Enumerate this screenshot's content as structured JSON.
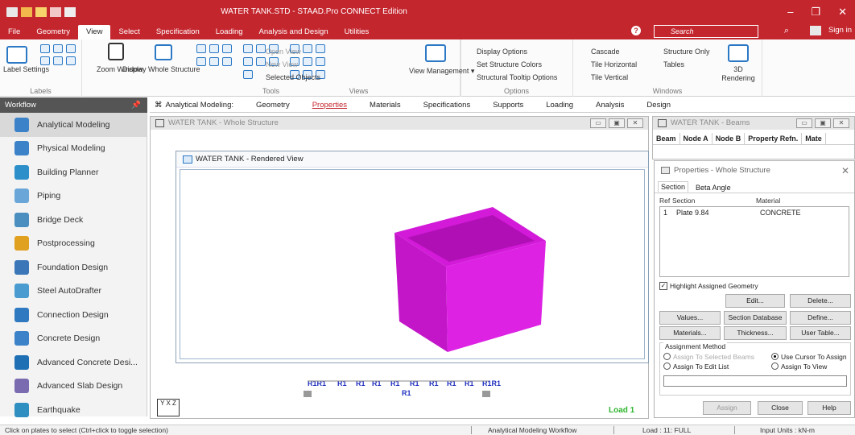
{
  "window": {
    "title": "WATER TANK.STD - STAAD.Pro CONNECT Edition",
    "search_placeholder": "Search",
    "signin": "Sign in",
    "controls": [
      "–",
      "❐",
      "✕"
    ]
  },
  "menu": [
    "File",
    "Geometry",
    "View",
    "Select",
    "Specification",
    "Loading",
    "Analysis and Design",
    "Utilities"
  ],
  "menu_active": "View",
  "ribbon": {
    "labels_group": {
      "label": "Labels",
      "button": "Label Settings"
    },
    "tools_group": {
      "label": "Tools",
      "zoom": "Zoom Window",
      "display": "Display Whole Structure"
    },
    "views_group": {
      "label": "Views",
      "open_view": "Open View",
      "new_view": "New View",
      "selected_objects": "Selected Objects",
      "view_management": "View Management ▾"
    },
    "options_group": {
      "label": "Options",
      "display_options": "Display Options",
      "set_colors": "Set Structure Colors",
      "tooltip_options": "Structural Tooltip Options"
    },
    "windows_group": {
      "label": "Windows",
      "cascade": "Cascade",
      "tile_h": "Tile Horizontal",
      "tile_v": "Tile Vertical",
      "structure_only": "Structure Only",
      "tables": "Tables",
      "rendering": "3D Rendering"
    }
  },
  "workflow": {
    "header": "Workflow",
    "items": [
      "Analytical Modeling",
      "Physical Modeling",
      "Building Planner",
      "Piping",
      "Bridge Deck",
      "Postprocessing",
      "Foundation Design",
      "Steel AutoDrafter",
      "Connection Design",
      "Concrete Design",
      "Advanced Concrete Desi...",
      "Advanced Slab Design",
      "Earthquake"
    ],
    "active": "Analytical Modeling",
    "icon_colors": [
      "#3c82c8",
      "#3c82c8",
      "#2c8fc9",
      "#6aa7d8",
      "#4a8fbf",
      "#e0a020",
      "#3a76b8",
      "#4a9bd0",
      "#2f79c0",
      "#3c82c8",
      "#1f6fb5",
      "#7a6bb0",
      "#2f8fc0"
    ]
  },
  "page_tabs": [
    "Analytical Modeling:",
    "Geometry",
    "Properties",
    "Materials",
    "Specifications",
    "Supports",
    "Loading",
    "Analysis",
    "Design"
  ],
  "page_tab_active": "Properties",
  "whole_structure": {
    "title": "WATER TANK - Whole Structure"
  },
  "rendered_view": {
    "title": "WATER TANK - Rendered View",
    "model_color": "#d21ad8"
  },
  "beams_table": {
    "title": "WATER TANK - Beams",
    "columns": [
      "Beam",
      "Node A",
      "Node B",
      "Property Refn.",
      "Mate"
    ]
  },
  "plate_labels": {
    "row": [
      "R1R1",
      "R1",
      "R1",
      "R1",
      "R1",
      "R1",
      "R1",
      "R1",
      "R1",
      "R1R1"
    ],
    "center": "R1",
    "load": "Load 1",
    "axis": "Y  X  Z"
  },
  "properties": {
    "title": "Properties - Whole Structure",
    "tabs": [
      "Section",
      "Beta Angle"
    ],
    "columns": [
      "Ref",
      "Section",
      "Material"
    ],
    "rows": [
      {
        "ref": "1",
        "section": "Plate 9.84",
        "material": "CONCRETE"
      }
    ],
    "highlight": "Highlight Assigned Geometry",
    "buttons": {
      "edit": "Edit...",
      "delete": "Delete...",
      "values": "Values...",
      "section_db": "Section Database",
      "define": "Define...",
      "materials": "Materials...",
      "thickness": "Thickness...",
      "user_table": "User Table..."
    },
    "assignment": {
      "label": "Assignment Method",
      "selected_beams": "Assign To Selected Beams",
      "cursor": "Use Cursor To Assign",
      "edit_list": "Assign To Edit List",
      "view": "Assign To View"
    },
    "footer": {
      "assign": "Assign",
      "close": "Close",
      "help": "Help"
    }
  },
  "status": {
    "hint": "Click on plates to select (Ctrl+click to toggle selection)",
    "workflow": "Analytical Modeling Workflow",
    "load": "Load : 11: FULL",
    "units": "Input Units : kN-m"
  }
}
